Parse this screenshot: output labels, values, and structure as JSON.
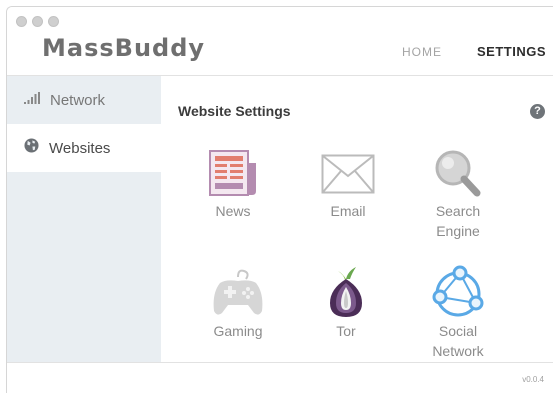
{
  "app": {
    "logo": "MassBuddy",
    "version": "v0.0.4"
  },
  "topnav": {
    "home": "HOME",
    "settings": "SETTINGS"
  },
  "sidebar": {
    "items": [
      {
        "label": "Network",
        "icon": "signal-bars-icon",
        "active": false
      },
      {
        "label": "Websites",
        "icon": "globe-icon",
        "active": true
      }
    ]
  },
  "main": {
    "title": "Website Settings",
    "help": "?",
    "tiles": [
      {
        "lines": [
          "News"
        ],
        "icon": "newspaper-icon"
      },
      {
        "lines": [
          "Email"
        ],
        "icon": "envelope-icon"
      },
      {
        "lines": [
          "Search",
          "Engine"
        ],
        "icon": "magnifier-icon"
      },
      {
        "lines": [
          "Gaming"
        ],
        "icon": "gamepad-icon"
      },
      {
        "lines": [
          "Tor"
        ],
        "icon": "tor-onion-icon"
      },
      {
        "lines": [
          "Social",
          "Network"
        ],
        "icon": "social-network-icon"
      }
    ]
  },
  "colors": {
    "sidebar_bg": "#e9eef2",
    "text": "#8b8b8b",
    "accent_blue": "#5aa9e6"
  }
}
